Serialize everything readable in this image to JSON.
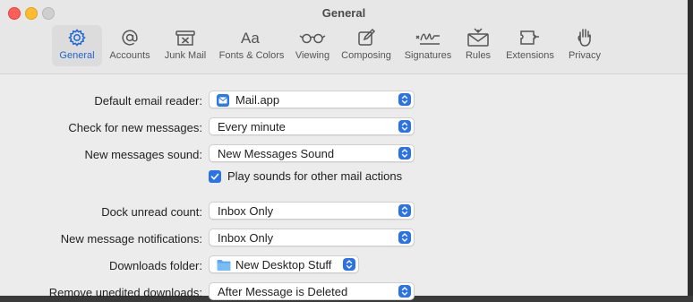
{
  "window": {
    "title": "General"
  },
  "toolbar": {
    "tabs": [
      {
        "label": "General",
        "icon": "gear-icon",
        "active": true
      },
      {
        "label": "Accounts",
        "icon": "at-icon"
      },
      {
        "label": "Junk Mail",
        "icon": "junk-mail-icon"
      },
      {
        "label": "Fonts & Colors",
        "icon": "fonts-icon"
      },
      {
        "label": "Viewing",
        "icon": "glasses-icon"
      },
      {
        "label": "Composing",
        "icon": "compose-icon"
      },
      {
        "label": "Signatures",
        "icon": "signature-icon"
      },
      {
        "label": "Rules",
        "icon": "rules-icon"
      },
      {
        "label": "Extensions",
        "icon": "extensions-icon"
      },
      {
        "label": "Privacy",
        "icon": "hand-icon"
      }
    ]
  },
  "settings": {
    "default_email_reader": {
      "label": "Default email reader:",
      "value": "Mail.app"
    },
    "check_new_messages": {
      "label": "Check for new messages:",
      "value": "Every minute"
    },
    "new_messages_sound": {
      "label": "New messages sound:",
      "value": "New Messages Sound"
    },
    "play_sounds": {
      "label": "Play sounds for other mail actions",
      "checked": true
    },
    "dock_unread_count": {
      "label": "Dock unread count:",
      "value": "Inbox Only"
    },
    "new_message_notifications": {
      "label": "New message notifications:",
      "value": "Inbox Only"
    },
    "downloads_folder": {
      "label": "Downloads folder:",
      "value": "New Desktop Stuff"
    },
    "remove_unedited_downloads": {
      "label": "Remove unedited downloads:",
      "value": "After Message is Deleted"
    }
  },
  "colors": {
    "accent": "#2a72e5",
    "window_bg": "#ececec"
  }
}
